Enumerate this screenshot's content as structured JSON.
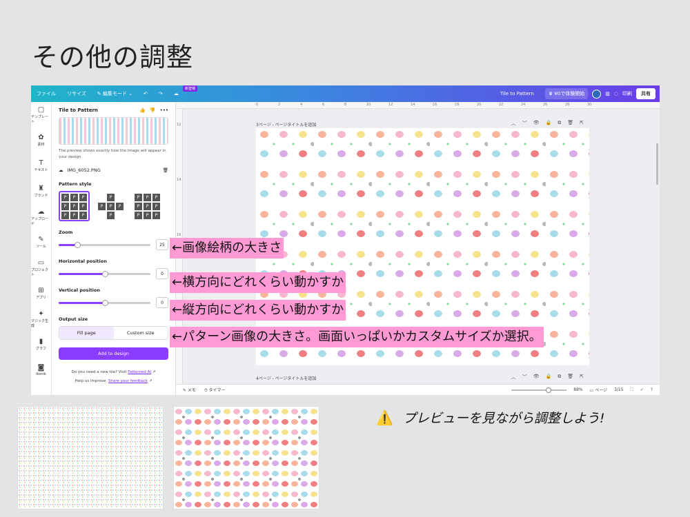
{
  "title": "その他の調整",
  "topbar": {
    "file": "ファイル",
    "resize": "リサイズ",
    "edit_mode": "✎ 編集モード ⌄",
    "undo": "↶",
    "redo": "↷",
    "new_badge": "新登場",
    "app_name": "Tile to Pattern",
    "trial": "♛ ¥0で体験開始",
    "print": "印刷",
    "share": "共有"
  },
  "rail": [
    {
      "icon": "▢",
      "label": "テンプレート"
    },
    {
      "icon": "✿",
      "label": "素材"
    },
    {
      "icon": "T",
      "label": "テキスト"
    },
    {
      "icon": "♜",
      "label": "ブランド"
    },
    {
      "icon": "☁",
      "label": "アップロード"
    },
    {
      "icon": "✎",
      "label": "ツール"
    },
    {
      "icon": "▭",
      "label": "プロジェクト"
    },
    {
      "icon": "⊞",
      "label": "アプリ"
    },
    {
      "icon": "✦",
      "label": "マジック生成"
    },
    {
      "icon": "▮",
      "label": "グラフ"
    },
    {
      "icon": "◙",
      "label": "Ikonik"
    }
  ],
  "panel": {
    "title": "Tile to Pattern",
    "preview_note": "The preview shows exactly how the image will appear in your design",
    "file_name": "IMG_6052.PNG",
    "pattern_style_label": "Pattern style",
    "zoom_label": "Zoom",
    "zoom_value": "25",
    "zoom_fraction": 0.2,
    "h_label": "Horizontal position",
    "h_value": "0",
    "h_fraction": 0.5,
    "v_label": "Vertical position",
    "v_value": "0",
    "v_fraction": 0.5,
    "output_label": "Output size",
    "fill_page": "Fill page",
    "custom_size": "Custom size",
    "add_button": "Add to design",
    "foot_q": "Do you need a new tile? Visit",
    "foot_link1": "Patterned AI",
    "foot_help": "Help us improve.",
    "foot_link2": "Share your feedback"
  },
  "ruler_h": [
    "0",
    "2",
    "4",
    "6",
    "8",
    "10",
    "12",
    "14",
    "16",
    "18",
    "20",
    "22",
    "24",
    "26",
    "28",
    "30"
  ],
  "ruler_v": [
    "12",
    "14",
    "16",
    "18",
    "20"
  ],
  "canvas": {
    "page3_label": "3ページ - ページタイトルを追加",
    "page4_label": "4ページ - ページタイトルを追加",
    "page_tools": [
      "︿",
      "﹀",
      "👁",
      "🔒",
      "⧉",
      "🗑",
      "⇱"
    ],
    "notes": "✎ メモ",
    "timer": "⏱ タイマー",
    "zoom_pct": "88%",
    "pages_btn": "▭ ページ",
    "page_count": "3/15"
  },
  "annotations": [
    "←画像絵柄の大きさ",
    "←横方向にどれくらい動かすか",
    "←縦方向にどれくらい動かすか",
    "←パターン画像の大きさ。画面いっぱいかカスタムサイズか選択。"
  ],
  "tip": {
    "icon": "⚠️",
    "text": "プレビューを見ながら調整しよう!"
  }
}
